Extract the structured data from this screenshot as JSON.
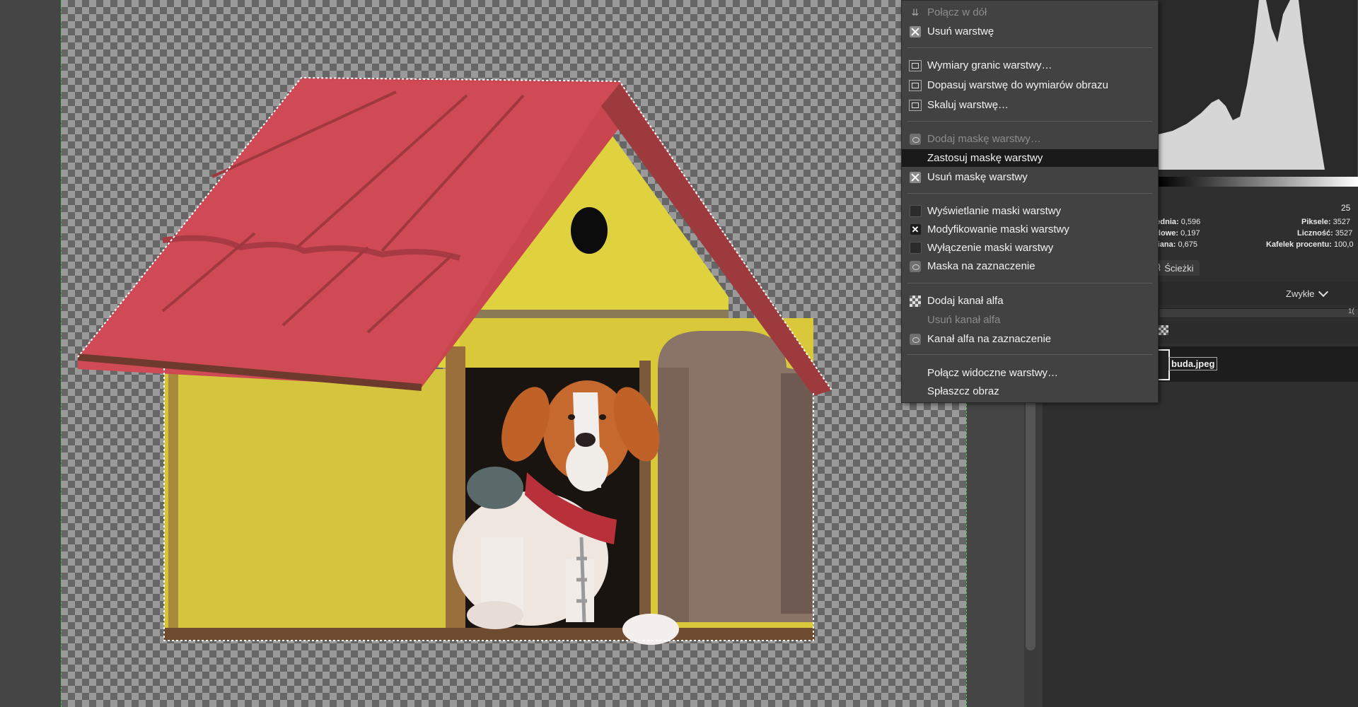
{
  "canvas": {
    "image_description_name": "buda.jpeg"
  },
  "context_menu": {
    "items": [
      {
        "label": "Połącz w dół",
        "icon": "merge-down-icon",
        "disabled": true
      },
      {
        "label": "Usuń warstwę",
        "icon": "delete-icon"
      },
      {
        "label": "Wymiary granic warstwy…",
        "icon": "layer-boundary-icon"
      },
      {
        "label": "Dopasuj warstwę do wymiarów obrazu",
        "icon": "layer-to-image-icon"
      },
      {
        "label": "Skaluj warstwę…",
        "icon": "scale-layer-icon"
      },
      {
        "label": "Dodaj maskę warstwy…",
        "icon": "add-mask-icon",
        "disabled": true
      },
      {
        "label": "Zastosuj maskę warstwy",
        "icon": "",
        "active": true
      },
      {
        "label": "Usuń maskę warstwy",
        "icon": "delete-icon"
      },
      {
        "label": "Wyświetlanie maski warstwy",
        "icon": "checkbox-icon",
        "checked": false
      },
      {
        "label": "Modyfikowanie maski warstwy",
        "icon": "checkbox-icon",
        "checked": true
      },
      {
        "label": "Wyłączenie maski warstwy",
        "icon": "checkbox-icon",
        "checked": false
      },
      {
        "label": "Maska na zaznaczenie",
        "icon": "mask-to-selection-icon"
      },
      {
        "label": "Dodaj kanał alfa",
        "icon": "alpha-channel-icon"
      },
      {
        "label": "Usuń kanał alfa",
        "icon": "",
        "disabled": true
      },
      {
        "label": "Kanał alfa na zaznaczenie",
        "icon": "alpha-to-selection-icon"
      },
      {
        "label": "Połącz widoczne warstwy…",
        "icon": ""
      },
      {
        "label": "Spłaszcz obraz",
        "icon": ""
      }
    ]
  },
  "histogram": {
    "range_value": "25",
    "stats_left": [
      {
        "label": "rednia:",
        "value": "0,596"
      },
      {
        "label": "rdowe:",
        "value": "0,197"
      },
      {
        "label": "diana:",
        "value": "0,675"
      }
    ],
    "stats_right": [
      {
        "label": "Piksele:",
        "value": "3527"
      },
      {
        "label": "Liczność:",
        "value": "3527"
      },
      {
        "label": "Kafelek procentu:",
        "value": "100,0"
      }
    ]
  },
  "layers_panel": {
    "tab_paths": "Ścieżki",
    "mode": "Zwykłe",
    "opacity_value": "1(",
    "layer_name": "buda.jpeg"
  },
  "colors": {
    "roof": "#c94650",
    "walls": "#d8c83a",
    "door": "#8b7468",
    "menu_bg": "#424242",
    "menu_active": "#1a1a1a"
  }
}
